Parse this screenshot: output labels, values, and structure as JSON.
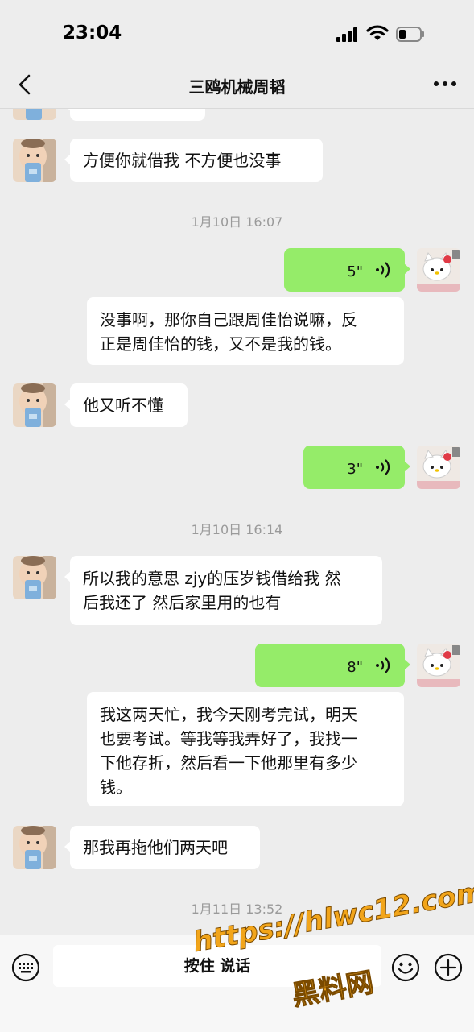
{
  "status_bar": {
    "time": "23:04"
  },
  "header": {
    "title": "三鸥机械周韬"
  },
  "messages": [
    {
      "type": "partial",
      "side": "in"
    },
    {
      "type": "text",
      "side": "in",
      "text": "方便你就借我 不方便也没事"
    },
    {
      "type": "time",
      "text": "1月10日 16:07"
    },
    {
      "type": "voice",
      "side": "out",
      "duration": "5\"",
      "transcript": "没事啊，那你自己跟周佳怡说嘛，反正是周佳怡的钱，又不是我的钱。"
    },
    {
      "type": "text",
      "side": "in",
      "text": "他又听不懂"
    },
    {
      "type": "voice",
      "side": "out",
      "duration": "3\""
    },
    {
      "type": "time",
      "text": "1月10日 16:14"
    },
    {
      "type": "text",
      "side": "in",
      "text": "所以我的意思 zjy的压岁钱借给我 然后我还了 然后家里用的也有"
    },
    {
      "type": "voice",
      "side": "out",
      "duration": "8\"",
      "transcript": "我这两天忙，我今天刚考完试，明天也要考试。等我等我弄好了，我找一下他存折，然后看一下他那里有多少钱。"
    },
    {
      "type": "text",
      "side": "in",
      "text": "那我再拖他们两天吧"
    },
    {
      "type": "time",
      "text": "1月11日 13:52"
    }
  ],
  "transcript_lines": {
    "t1": [
      "没事啊，那你自己跟周佳怡说嘛，反",
      "正是周佳怡的钱，又不是我的钱。"
    ],
    "t2": [
      "所以我的意思 zjy的压岁钱借给我 然",
      "后我还了 然后家里用的也有"
    ],
    "t3": [
      "我这两天忙，我今天刚考完试，明天",
      "也要考试。等我等我弄好了，我找一",
      "下他存折，然后看一下他那里有多少",
      "钱。"
    ]
  },
  "input_bar": {
    "hold_to_talk": "按住 说话"
  },
  "watermark": {
    "url": "https://hlwc12.com",
    "name": "黑料网"
  },
  "icons": [
    "back-icon",
    "more-icon",
    "voice-wave-icon",
    "keyboard-icon",
    "emoji-icon",
    "plus-icon",
    "signal-icon",
    "wifi-icon",
    "battery-icon"
  ],
  "colors": {
    "outgoing_bubble": "#95ec69",
    "incoming_bubble": "#ffffff",
    "background": "#ededed",
    "watermark": "#f2a51a"
  }
}
